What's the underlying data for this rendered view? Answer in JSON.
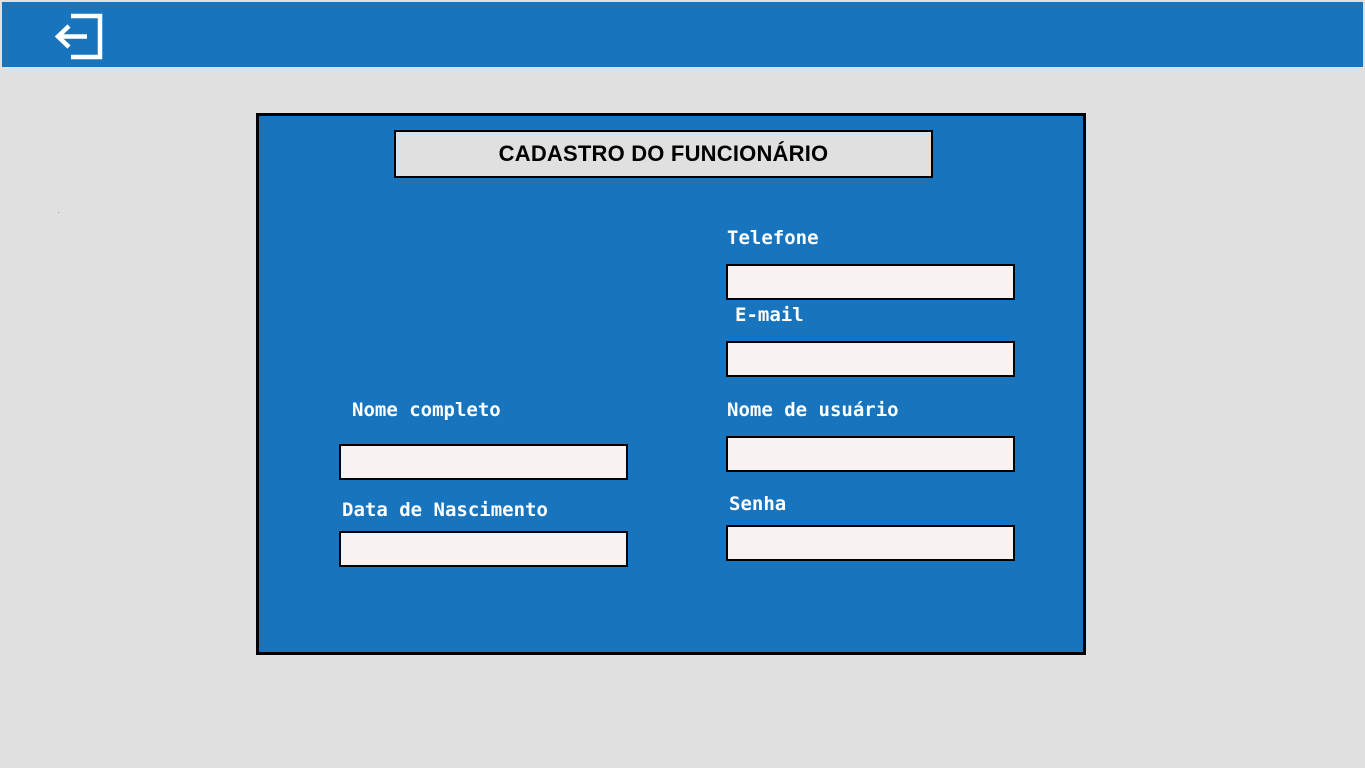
{
  "header": {
    "back_icon": "exit-arrow-left-icon"
  },
  "form": {
    "title": "CADASTRO DO FUNCIONÁRIO",
    "fields": {
      "telefone": {
        "label": "Telefone",
        "value": ""
      },
      "email": {
        "label": "E-mail",
        "value": ""
      },
      "nome_completo": {
        "label": "Nome completo",
        "value": ""
      },
      "nome_usuario": {
        "label": "Nome de usuário",
        "value": ""
      },
      "data_nascimento": {
        "label": "Data de Nascimento",
        "value": ""
      },
      "senha": {
        "label": "Senha",
        "value": ""
      }
    }
  },
  "colors": {
    "primary_blue": "#1874bd",
    "background_gray": "#e0e0e0",
    "input_background": "#f8f2f2",
    "border": "#000000"
  }
}
